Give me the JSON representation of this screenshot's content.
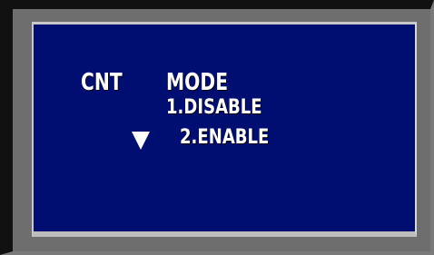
{
  "osd": {
    "menu_title": "CNT",
    "setting_label": "MODE",
    "options": [
      {
        "label": "1.DISABLE",
        "selected": false
      },
      {
        "label": "2.ENABLE",
        "selected": true
      }
    ],
    "cursor_icon": "down-triangle-icon"
  },
  "colors": {
    "screen_background": "#000E72",
    "text": "#FFFFFF",
    "frame": "#6E6E6E"
  }
}
